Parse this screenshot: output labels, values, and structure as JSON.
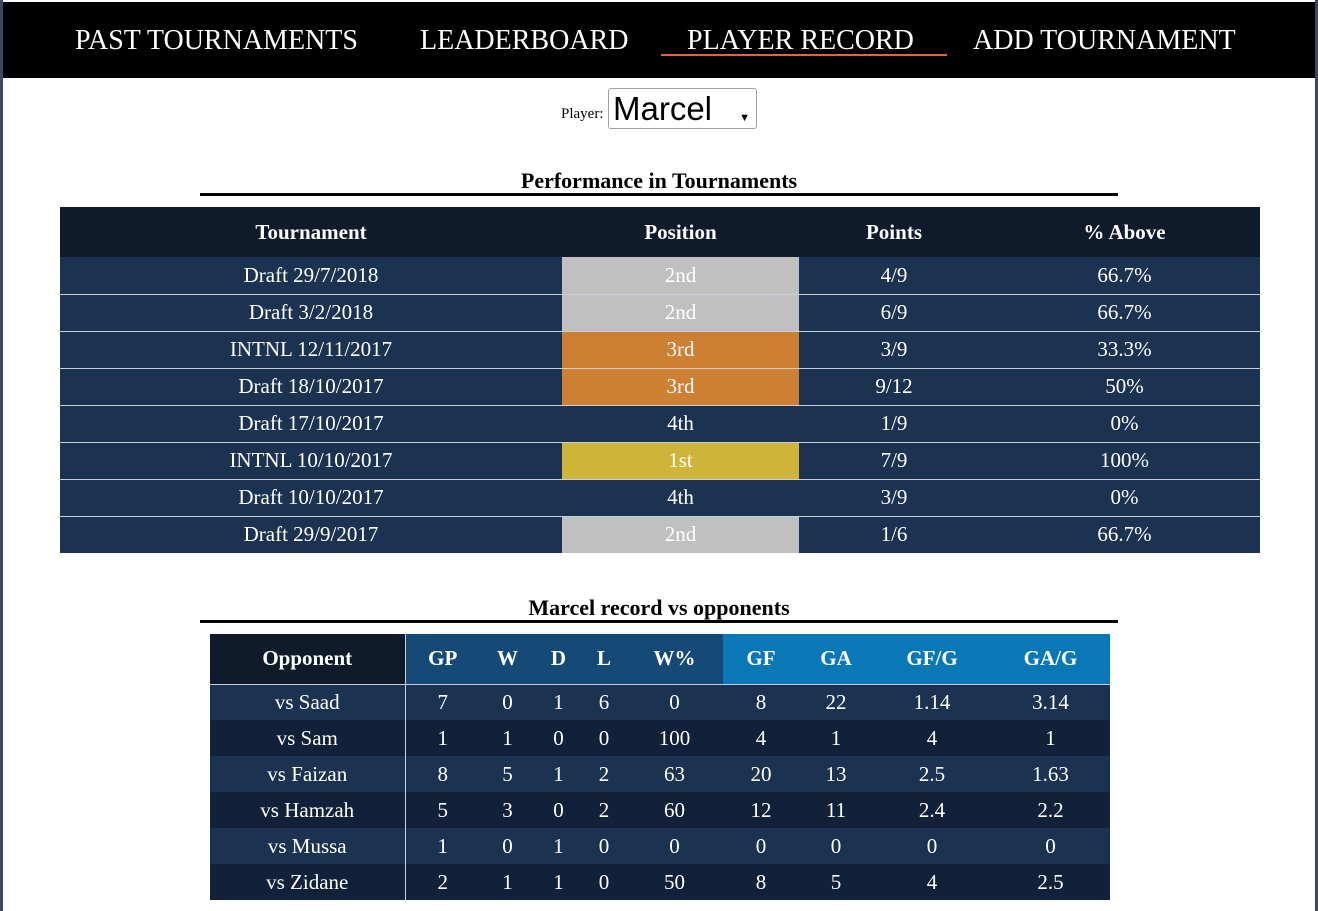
{
  "nav": {
    "items": [
      {
        "label": "PAST TOURNAMENTS"
      },
      {
        "label": "LEADERBOARD"
      },
      {
        "label": "PLAYER RECORD"
      },
      {
        "label": "ADD TOURNAMENT"
      }
    ],
    "active": "PLAYER RECORD",
    "underline_color": "#e8604c"
  },
  "player": {
    "label": "Player:",
    "selected": "Marcel",
    "arrow_icon": "triangle-down-icon"
  },
  "performance": {
    "title": "Performance in Tournaments",
    "headers": [
      "Tournament",
      "Position",
      "Points",
      "% Above"
    ],
    "rows": [
      {
        "tournament": "Draft 29/7/2018",
        "position": "2nd",
        "medal": "silver",
        "points": "4/9",
        "above": "66.7%"
      },
      {
        "tournament": "Draft 3/2/2018",
        "position": "2nd",
        "medal": "silver",
        "points": "6/9",
        "above": "66.7%"
      },
      {
        "tournament": "INTNL 12/11/2017",
        "position": "3rd",
        "medal": "bronze",
        "points": "3/9",
        "above": "33.3%"
      },
      {
        "tournament": "Draft 18/10/2017",
        "position": "3rd",
        "medal": "bronze",
        "points": "9/12",
        "above": "50%"
      },
      {
        "tournament": "Draft 17/10/2017",
        "position": "4th",
        "medal": "none",
        "points": "1/9",
        "above": "0%"
      },
      {
        "tournament": "INTNL 10/10/2017",
        "position": "1st",
        "medal": "gold",
        "points": "7/9",
        "above": "100%"
      },
      {
        "tournament": "Draft 10/10/2017",
        "position": "4th",
        "medal": "none",
        "points": "3/9",
        "above": "0%"
      },
      {
        "tournament": "Draft 29/9/2017",
        "position": "2nd",
        "medal": "silver",
        "points": "1/6",
        "above": "66.7%"
      }
    ],
    "medal_colors": {
      "gold": "#cfb43a",
      "silver": "#c0c0c0",
      "bronze": "#cd7f32"
    }
  },
  "opponents": {
    "title": "Marcel record vs opponents",
    "headers": [
      "Opponent",
      "GP",
      "W",
      "D",
      "L",
      "W%",
      "GF",
      "GA",
      "GF/G",
      "GA/G"
    ],
    "rows": [
      [
        "vs Saad",
        "7",
        "0",
        "1",
        "6",
        "0",
        "8",
        "22",
        "1.14",
        "3.14"
      ],
      [
        "vs Sam",
        "1",
        "1",
        "0",
        "0",
        "100",
        "4",
        "1",
        "4",
        "1"
      ],
      [
        "vs Faizan",
        "8",
        "5",
        "1",
        "2",
        "63",
        "20",
        "13",
        "2.5",
        "1.63"
      ],
      [
        "vs Hamzah",
        "5",
        "3",
        "0",
        "2",
        "60",
        "12",
        "11",
        "2.4",
        "2.2"
      ],
      [
        "vs Mussa",
        "1",
        "0",
        "1",
        "0",
        "0",
        "0",
        "0",
        "0",
        "0"
      ],
      [
        "vs Zidane",
        "2",
        "1",
        "1",
        "0",
        "50",
        "8",
        "5",
        "4",
        "2.5"
      ]
    ]
  }
}
